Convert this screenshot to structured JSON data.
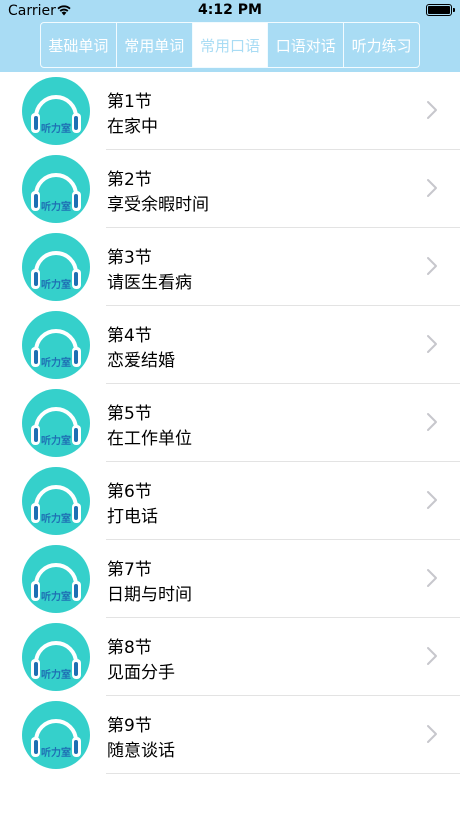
{
  "status_bar": {
    "carrier": "Carrier",
    "time": "4:12 PM"
  },
  "tabs": [
    {
      "label": "基础单词",
      "active": false
    },
    {
      "label": "常用单词",
      "active": false
    },
    {
      "label": "常用口语",
      "active": true
    },
    {
      "label": "口语对话",
      "active": false
    },
    {
      "label": "听力练习",
      "active": false
    }
  ],
  "lessons": [
    {
      "section": "第1节",
      "title": "在家中",
      "logo": "听力室"
    },
    {
      "section": "第2节",
      "title": "享受余暇时间",
      "logo": "听力室"
    },
    {
      "section": "第3节",
      "title": "请医生看病",
      "logo": "听力室"
    },
    {
      "section": "第4节",
      "title": "恋爱结婚",
      "logo": "听力室"
    },
    {
      "section": "第5节",
      "title": "在工作单位",
      "logo": "听力室"
    },
    {
      "section": "第6节",
      "title": "打电话",
      "logo": "听力室"
    },
    {
      "section": "第7节",
      "title": "日期与时间",
      "logo": "听力室"
    },
    {
      "section": "第8节",
      "title": "见面分手",
      "logo": "听力室"
    },
    {
      "section": "第9节",
      "title": "随意谈话",
      "logo": "听力室"
    }
  ],
  "colors": {
    "header": "#a9dcf4",
    "avatar": "#35d0cb",
    "separator": "#e3e3e3",
    "chevron": "#c7c7cc"
  },
  "icons": {
    "avatar": "headphones-icon",
    "row_accessory": "chevron-right-icon",
    "wifi": "wifi-icon",
    "battery": "battery-icon"
  }
}
